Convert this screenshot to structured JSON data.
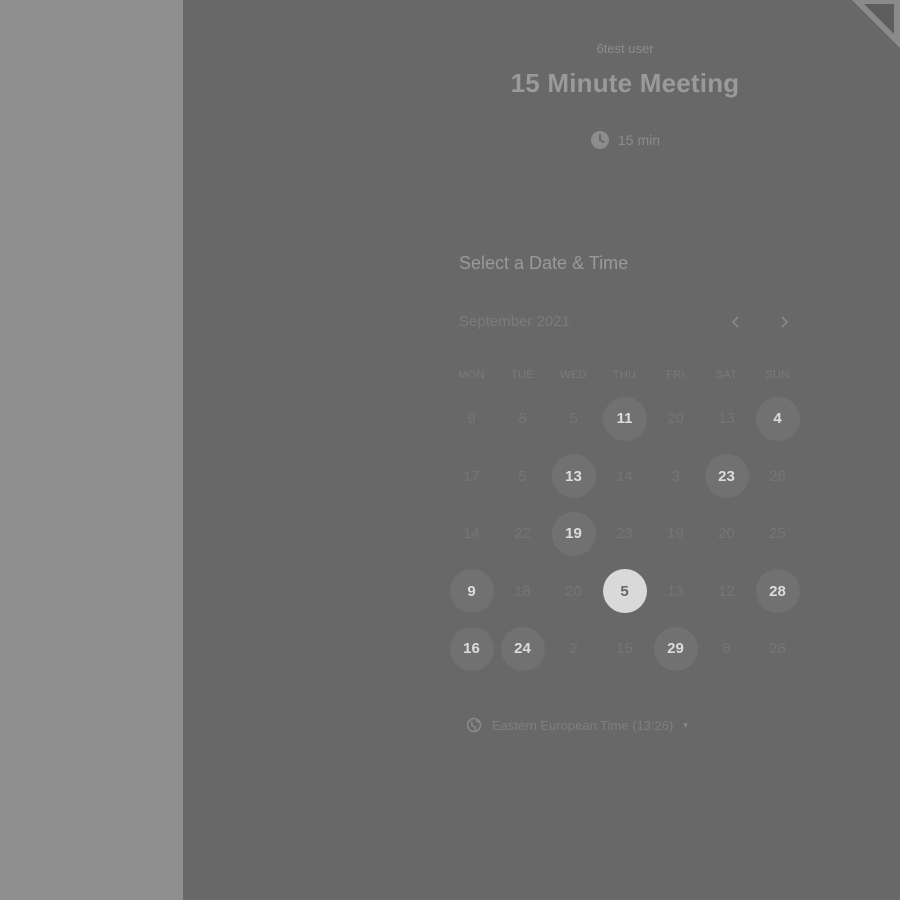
{
  "organizer": "6test user",
  "event_title": "15 Minute Meeting",
  "duration": {
    "icon": "clock-icon",
    "label": "15 min"
  },
  "section_heading": "Select a Date & Time",
  "calendar": {
    "month_label": "September 2021",
    "prev_icon": "chevron-left-icon",
    "next_icon": "chevron-right-icon",
    "weekdays": [
      "MON",
      "TUE",
      "WED",
      "THU",
      "FRI",
      "SAT",
      "SUN"
    ],
    "weeks": [
      [
        {
          "d": "9",
          "s": "u"
        },
        {
          "d": "8",
          "s": "u"
        },
        {
          "d": "5",
          "s": "u"
        },
        {
          "d": "11",
          "s": "a"
        },
        {
          "d": "20",
          "s": "u"
        },
        {
          "d": "13",
          "s": "u"
        },
        {
          "d": "4",
          "s": "a"
        }
      ],
      [
        {
          "d": "17",
          "s": "u"
        },
        {
          "d": "5",
          "s": "u"
        },
        {
          "d": "13",
          "s": "a"
        },
        {
          "d": "14",
          "s": "u"
        },
        {
          "d": "3",
          "s": "u"
        },
        {
          "d": "23",
          "s": "a"
        },
        {
          "d": "26",
          "s": "u"
        }
      ],
      [
        {
          "d": "14",
          "s": "u"
        },
        {
          "d": "22",
          "s": "u"
        },
        {
          "d": "19",
          "s": "a"
        },
        {
          "d": "23",
          "s": "u"
        },
        {
          "d": "19",
          "s": "u"
        },
        {
          "d": "20",
          "s": "u"
        },
        {
          "d": "25",
          "s": "u"
        }
      ],
      [
        {
          "d": "9",
          "s": "a"
        },
        {
          "d": "18",
          "s": "u"
        },
        {
          "d": "20",
          "s": "u"
        },
        {
          "d": "5",
          "s": "selected"
        },
        {
          "d": "13",
          "s": "u"
        },
        {
          "d": "12",
          "s": "u"
        },
        {
          "d": "28",
          "s": "a"
        }
      ],
      [
        {
          "d": "16",
          "s": "a"
        },
        {
          "d": "24",
          "s": "a"
        },
        {
          "d": "2",
          "s": "u"
        },
        {
          "d": "15",
          "s": "u"
        },
        {
          "d": "29",
          "s": "a"
        },
        {
          "d": "8",
          "s": "u"
        },
        {
          "d": "28",
          "s": "u"
        }
      ]
    ],
    "state_legend": {
      "a": "available",
      "u": "unavailable",
      "selected": "selected"
    }
  },
  "timezone": {
    "icon": "globe-icon",
    "label": "Eastern European Time (13:26)",
    "caret": "▾"
  },
  "colors": {
    "background": "#686868",
    "left_pane": "#8f8f8f",
    "available_day": "#717171",
    "selected_day": "#d9d9d9"
  }
}
